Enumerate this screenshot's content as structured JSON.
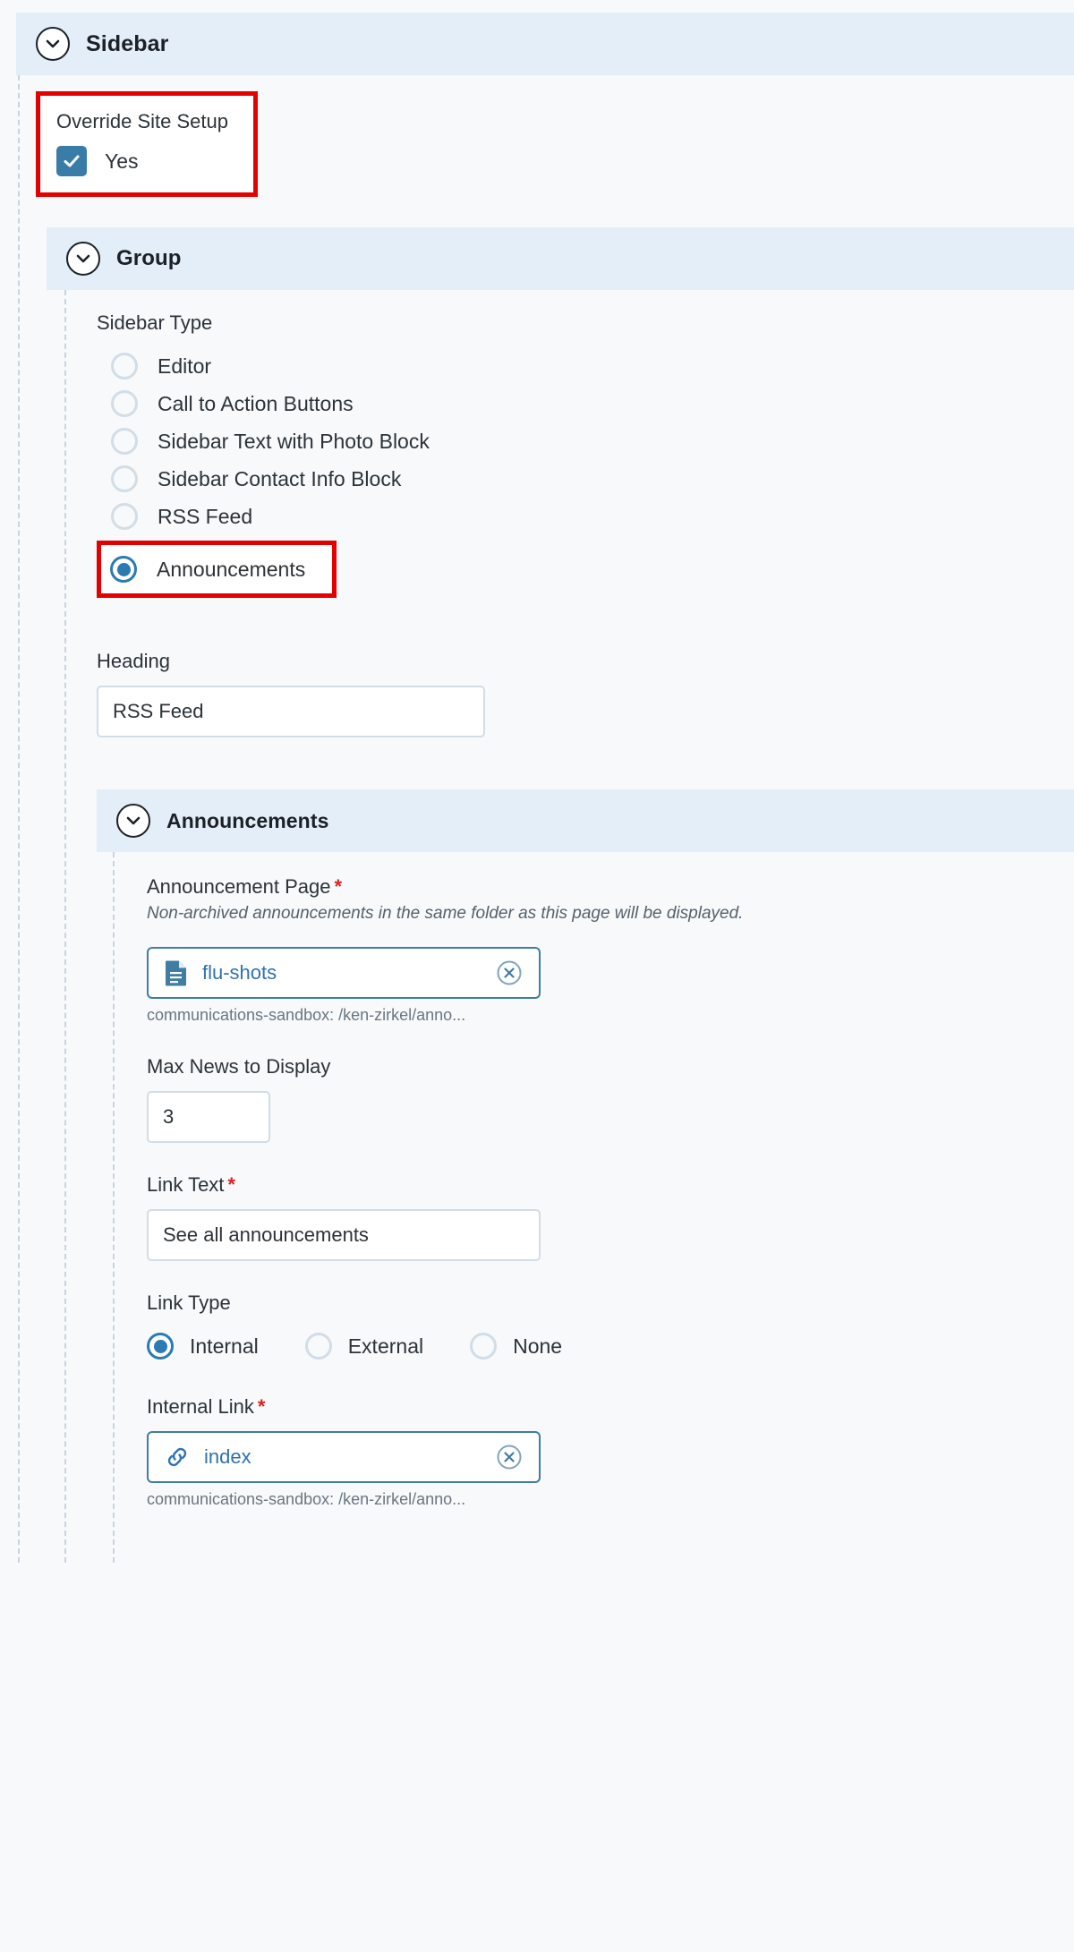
{
  "panels": {
    "sidebar": {
      "title": "Sidebar",
      "icon": "chevron-down-icon"
    },
    "group": {
      "title": "Group",
      "icon": "chevron-down-icon"
    },
    "announcements": {
      "title": "Announcements",
      "icon": "chevron-down-icon"
    }
  },
  "override_site_setup": {
    "label": "Override Site Setup",
    "checkbox_label": "Yes",
    "checked": true,
    "highlight_color": "#e30000"
  },
  "sidebar_type": {
    "label": "Sidebar Type",
    "selected": "Announcements",
    "options": [
      {
        "label": "Editor",
        "selected": false
      },
      {
        "label": "Call to Action Buttons",
        "selected": false
      },
      {
        "label": "Sidebar Text with Photo Block",
        "selected": false
      },
      {
        "label": "Sidebar Contact Info Block",
        "selected": false
      },
      {
        "label": "RSS Feed",
        "selected": false
      },
      {
        "label": "Announcements",
        "selected": true,
        "highlighted": true
      }
    ]
  },
  "heading": {
    "label": "Heading",
    "value": "RSS Feed",
    "placeholder": ""
  },
  "announcement_page": {
    "label": "Announcement Page",
    "required_marker": "*",
    "helper": "Non-archived announcements in the same folder as this page will be displayed.",
    "chip_text": "flu-shots",
    "chip_icon": "page-document-icon",
    "clear_icon": "clear-circle-x-icon",
    "path": "communications-sandbox: /ken-zirkel/anno..."
  },
  "max_news": {
    "label": "Max News to Display",
    "value": "3",
    "placeholder": ""
  },
  "link_text": {
    "label": "Link Text",
    "required_marker": "*",
    "value": "See all announcements",
    "placeholder": ""
  },
  "link_type": {
    "label": "Link Type",
    "selected": "Internal",
    "options": [
      {
        "label": "Internal",
        "selected": true
      },
      {
        "label": "External",
        "selected": false
      },
      {
        "label": "None",
        "selected": false
      }
    ]
  },
  "internal_link": {
    "label": "Internal Link",
    "required_marker": "*",
    "chip_text": "index",
    "chip_icon": "link-chain-icon",
    "clear_icon": "clear-circle-x-icon",
    "path": "communications-sandbox: /ken-zirkel/anno..."
  },
  "colors": {
    "panel_header_bg": "#e4eef8",
    "accent_blue": "#2b7bb0",
    "highlight_red": "#e30000",
    "page_bg": "#f7f9fb"
  }
}
